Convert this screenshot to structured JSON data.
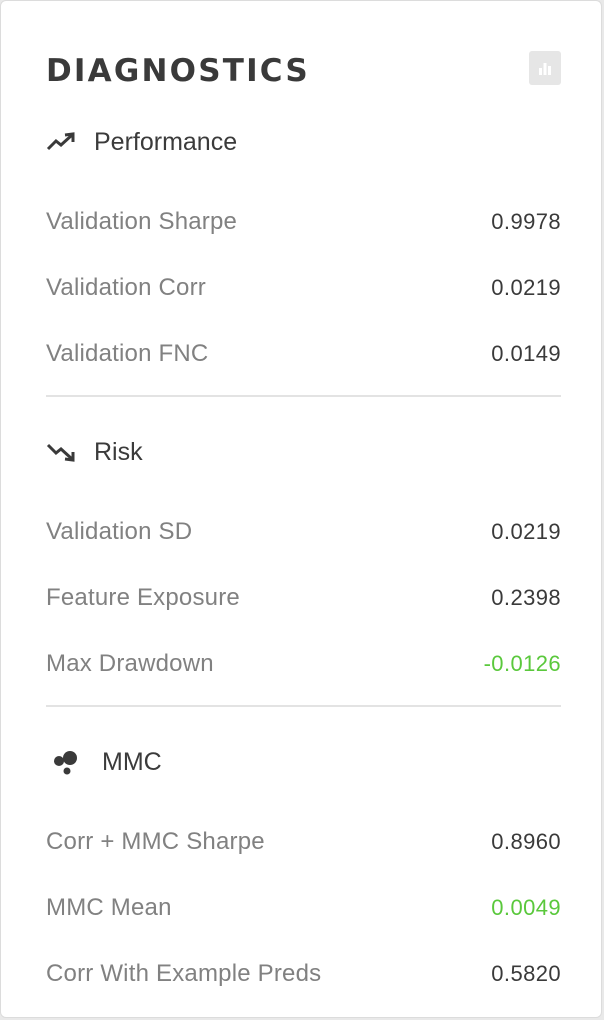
{
  "panel": {
    "title": "DIAGNOSTICS",
    "chart_button_icon": "bar-chart-icon"
  },
  "sections": [
    {
      "label": "Performance",
      "icon": "trending-up-icon",
      "rows": [
        {
          "label": "Validation Sharpe",
          "value": "0.9978"
        },
        {
          "label": "Validation Corr",
          "value": "0.0219"
        },
        {
          "label": "Validation FNC",
          "value": "0.0149"
        }
      ]
    },
    {
      "label": "Risk",
      "icon": "trending-down-icon",
      "rows": [
        {
          "label": "Validation SD",
          "value": "0.0219"
        },
        {
          "label": "Feature Exposure",
          "value": "0.2398"
        },
        {
          "label": "Max Drawdown",
          "value": "-0.0126"
        }
      ]
    },
    {
      "label": "MMC",
      "icon": "bubbles-icon",
      "rows": [
        {
          "label": "Corr + MMC Sharpe",
          "value": "0.8960"
        },
        {
          "label": "MMC Mean",
          "value": "0.0049"
        },
        {
          "label": "Corr With Example Preds",
          "value": "0.5820"
        }
      ]
    }
  ],
  "colors": {
    "positive": "#5ac83c",
    "text": "#3a3a3a",
    "muted": "#818181"
  }
}
